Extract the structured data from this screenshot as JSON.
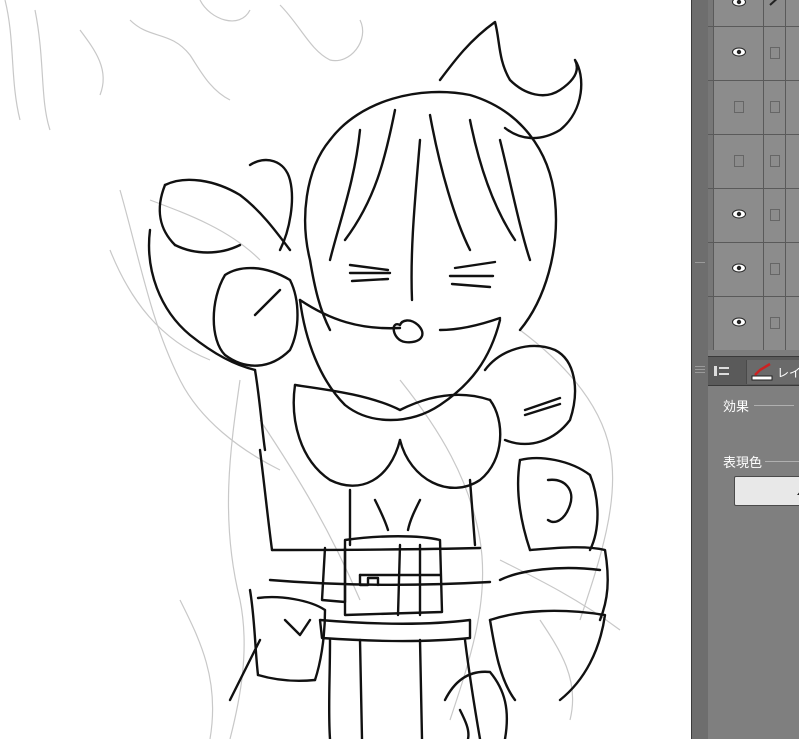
{
  "canvas": {
    "artwork": "line-art-character-sketch"
  },
  "layer_panel": {
    "rows": [
      {
        "visible": true
      },
      {
        "visible": true
      },
      {
        "visible": false
      },
      {
        "visible": false
      },
      {
        "visible": true
      },
      {
        "visible": true
      },
      {
        "visible": true
      }
    ]
  },
  "tabs": {
    "layer_tab_label": "レイ"
  },
  "properties": {
    "effect_label": "効果",
    "expression_color_label": "表現色"
  },
  "colors": {
    "panel_bg": "#7d7d7d",
    "canvas_bg": "#ffffff",
    "tab_accent": "#cc2222"
  }
}
